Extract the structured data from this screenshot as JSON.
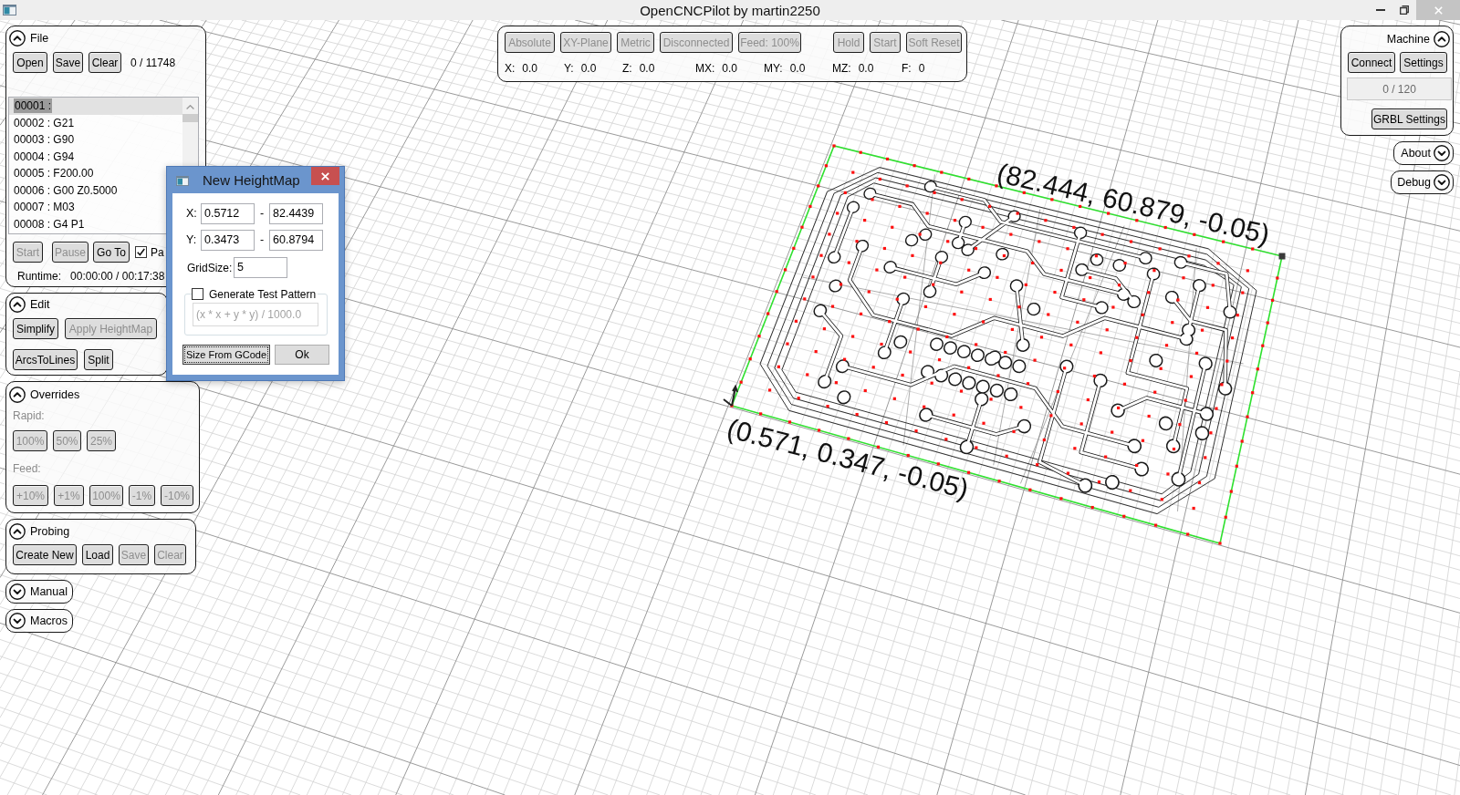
{
  "window": {
    "title": "OpenCNCPilot by martin2250"
  },
  "file_panel": {
    "title": "File",
    "expanded": true,
    "buttons": [
      {
        "label": "Open",
        "disabled": false
      },
      {
        "label": "Save",
        "disabled": false
      },
      {
        "label": "Clear",
        "disabled": false
      }
    ],
    "line_count": "0 / 11748",
    "lines": [
      {
        "text": "00001 :",
        "selected": true
      },
      {
        "text": "00002 : G21",
        "selected": false
      },
      {
        "text": "00003 : G90",
        "selected": false
      },
      {
        "text": "00004 : G94",
        "selected": false
      },
      {
        "text": "00005 : F200.00",
        "selected": false
      },
      {
        "text": "00006 : G00 Z0.5000",
        "selected": false
      },
      {
        "text": "00007 : M03",
        "selected": false
      },
      {
        "text": "00008 : G4 P1",
        "selected": false
      }
    ],
    "run_buttons": [
      {
        "label": "Start",
        "disabled": true
      },
      {
        "label": "Pause",
        "disabled": true
      },
      {
        "label": "Go To",
        "disabled": false
      }
    ],
    "pause_checkbox": {
      "label": "Pa",
      "checked": true
    },
    "runtime": {
      "label": "Runtime:",
      "value": "00:00:00 / 00:17:38"
    }
  },
  "edit_panel": {
    "title": "Edit",
    "expanded": true,
    "rows": [
      {
        "buttons": [
          {
            "label": "Simplify",
            "disabled": false
          },
          {
            "label": "Apply HeightMap",
            "disabled": true
          }
        ]
      },
      {
        "buttons": [
          {
            "label": "ArcsToLines",
            "disabled": false
          },
          {
            "label": "Split",
            "disabled": false
          }
        ]
      }
    ]
  },
  "overrides_panel": {
    "title": "Overrides",
    "expanded": true,
    "groups": [
      {
        "label": "Rapid:",
        "buttons": [
          {
            "label": "100%",
            "disabled": true
          },
          {
            "label": "50%",
            "disabled": true
          },
          {
            "label": "25%",
            "disabled": true
          }
        ]
      },
      {
        "label": "Feed:",
        "buttons": [
          {
            "label": "+10%",
            "disabled": true
          },
          {
            "label": "+1%",
            "disabled": true
          },
          {
            "label": "100%",
            "disabled": true
          },
          {
            "label": "-1%",
            "disabled": true
          },
          {
            "label": "-10%",
            "disabled": true
          }
        ]
      }
    ]
  },
  "probing_panel": {
    "title": "Probing",
    "expanded": true,
    "buttons": [
      {
        "label": "Create New",
        "disabled": false
      },
      {
        "label": "Load",
        "disabled": false
      },
      {
        "label": "Save",
        "disabled": true
      },
      {
        "label": "Clear",
        "disabled": true
      }
    ]
  },
  "collapsed_panels": [
    {
      "title": "Manual",
      "expanded": false
    },
    {
      "title": "Macros",
      "expanded": false
    }
  ],
  "status_toolbar": {
    "modes": [
      {
        "label": "Absolute",
        "disabled": true
      },
      {
        "label": "XY-Plane",
        "disabled": true
      },
      {
        "label": "Metric",
        "disabled": true
      },
      {
        "label": "Disconnected",
        "disabled": true
      },
      {
        "label": "Feed: 100%",
        "disabled": true
      }
    ],
    "controls": [
      {
        "label": "Hold",
        "disabled": true
      },
      {
        "label": "Start",
        "disabled": true
      },
      {
        "label": "Soft Reset",
        "disabled": true
      }
    ],
    "coordinates": [
      {
        "label": "X:",
        "value": "0.0"
      },
      {
        "label": "Y:",
        "value": "0.0"
      },
      {
        "label": "Z:",
        "value": "0.0"
      },
      {
        "label": "MX:",
        "value": "0.0"
      },
      {
        "label": "MY:",
        "value": "0.0"
      },
      {
        "label": "MZ:",
        "value": "0.0"
      },
      {
        "label": "F:",
        "value": "0"
      }
    ]
  },
  "machine_panel": {
    "title": "Machine",
    "expanded": true,
    "buttons": [
      {
        "label": "Connect",
        "disabled": false
      },
      {
        "label": "Settings",
        "disabled": false
      }
    ],
    "buffer": {
      "value": "0 / 120",
      "disabled": true
    },
    "grbl_button": {
      "label": "GRBL Settings",
      "disabled": false
    }
  },
  "side_panels": [
    {
      "title": "About",
      "expanded": false
    },
    {
      "title": "Debug",
      "expanded": false
    }
  ],
  "viewport": {
    "labels": [
      {
        "kind": "max_corner",
        "text": "(82.444, 60.879, -0.05)"
      },
      {
        "kind": "min_corner",
        "text": "(0.571, 0.347, -0.05)"
      }
    ]
  },
  "dialog": {
    "title": "New HeightMap",
    "fields": [
      {
        "label": "X:",
        "from": "0.5712",
        "separator": "-",
        "to": "82.4439"
      },
      {
        "label": "Y:",
        "from": "0.3473",
        "separator": "-",
        "to": "60.8794"
      }
    ],
    "grid_size": {
      "label": "GridSize:",
      "value": "5"
    },
    "test_pattern": {
      "label": "Generate Test Pattern",
      "checked": false,
      "formula": "(x * x + y * y) / 1000.0",
      "disabled": true
    },
    "buttons": [
      {
        "label": "Size From GCode",
        "focused": true
      },
      {
        "label": "Ok",
        "focused": false
      }
    ]
  }
}
